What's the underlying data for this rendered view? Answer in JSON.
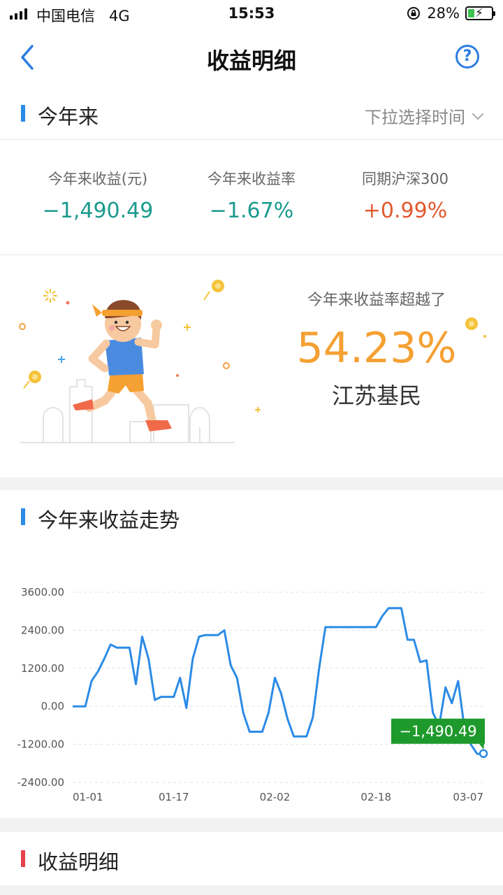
{
  "status_bar": {
    "carrier": "中国电信",
    "network": "4G",
    "time": "15:53",
    "battery": "28%",
    "battery_level": 0.28
  },
  "nav": {
    "title": "收益明细",
    "back_icon": "chevron-left-icon",
    "help_icon": "question-circle-icon",
    "help_glyph": "?"
  },
  "period": {
    "label": "今年来",
    "picker": "下拉选择时间"
  },
  "stats": [
    {
      "name": "今年来收益(元)",
      "value": "−1,490.49",
      "tone": "neg"
    },
    {
      "name": "今年来收益率",
      "value": "−1.67%",
      "tone": "neg"
    },
    {
      "name": "同期沪深300",
      "value": "+0.99%",
      "tone": "pos"
    }
  ],
  "ranking": {
    "description": "今年来收益率超越了",
    "percent": "54.23%",
    "group": "江苏基民"
  },
  "trend": {
    "title": "今年来收益走势",
    "tooltip": "−1,490.49"
  },
  "detail": {
    "title": "收益明细"
  },
  "colors": {
    "accent": "#2b8be6",
    "negative": "#1a9a8e",
    "positive": "#e2592f",
    "rank": "#f5a032",
    "tooltip": "#1e9a2c"
  },
  "chart_data": {
    "type": "line",
    "ylim": [
      -2400,
      3600
    ],
    "y_ticks": [
      "3600.00",
      "2400.00",
      "1200.00",
      "0.00",
      "-1200.00",
      "-2400.00"
    ],
    "y_tick_values": [
      3600,
      2400,
      1200,
      0,
      -1200,
      -2400
    ],
    "x_ticks": [
      "01-01",
      "01-17",
      "02-02",
      "02-18",
      "03-07"
    ],
    "x_tick_dates": [
      "2019-01-01",
      "2019-01-17",
      "2019-02-02",
      "2019-02-18",
      "2019-03-07"
    ],
    "grid": true,
    "series": [
      {
        "x": [
          "2019-01-01",
          "2019-01-02",
          "2019-01-03",
          "2019-01-04",
          "2019-01-05",
          "2019-01-06",
          "2019-01-07",
          "2019-01-08",
          "2019-01-09",
          "2019-01-10",
          "2019-01-11",
          "2019-01-12",
          "2019-01-13",
          "2019-01-14",
          "2019-01-15",
          "2019-01-16",
          "2019-01-17",
          "2019-01-18",
          "2019-01-19",
          "2019-01-20",
          "2019-01-21",
          "2019-01-22",
          "2019-01-23",
          "2019-01-24",
          "2019-01-25",
          "2019-01-26",
          "2019-01-27",
          "2019-01-28",
          "2019-01-29",
          "2019-01-30",
          "2019-01-31",
          "2019-02-01",
          "2019-02-02",
          "2019-02-03",
          "2019-02-04",
          "2019-02-05",
          "2019-02-06",
          "2019-02-07",
          "2019-02-08",
          "2019-02-09",
          "2019-02-10",
          "2019-02-11",
          "2019-02-12",
          "2019-02-13",
          "2019-02-14",
          "2019-02-15",
          "2019-02-16",
          "2019-02-17",
          "2019-02-18",
          "2019-02-19",
          "2019-02-20",
          "2019-02-21",
          "2019-02-22",
          "2019-02-23",
          "2019-02-24",
          "2019-02-25",
          "2019-02-26",
          "2019-02-27",
          "2019-02-28",
          "2019-03-01",
          "2019-03-02",
          "2019-03-03",
          "2019-03-04",
          "2019-03-05",
          "2019-03-06",
          "2019-03-07"
        ],
        "y": [
          0,
          0,
          0,
          800,
          1100,
          1500,
          1950,
          1850,
          1850,
          1850,
          700,
          2200,
          1500,
          200,
          300,
          300,
          300,
          900,
          -50,
          1500,
          2200,
          2250,
          2250,
          2250,
          2400,
          1300,
          900,
          -200,
          -800,
          -800,
          -800,
          -200,
          900,
          400,
          -400,
          -950,
          -950,
          -950,
          -350,
          1200,
          2500,
          2500,
          2500,
          2500,
          2500,
          2500,
          2500,
          2500,
          2500,
          2850,
          3100,
          3100,
          3100,
          2100,
          2100,
          1400,
          1450,
          -200,
          -600,
          600,
          100,
          800,
          -700,
          -1200,
          -1500,
          -1490.49
        ]
      }
    ],
    "point_label": "−1,490.49"
  }
}
